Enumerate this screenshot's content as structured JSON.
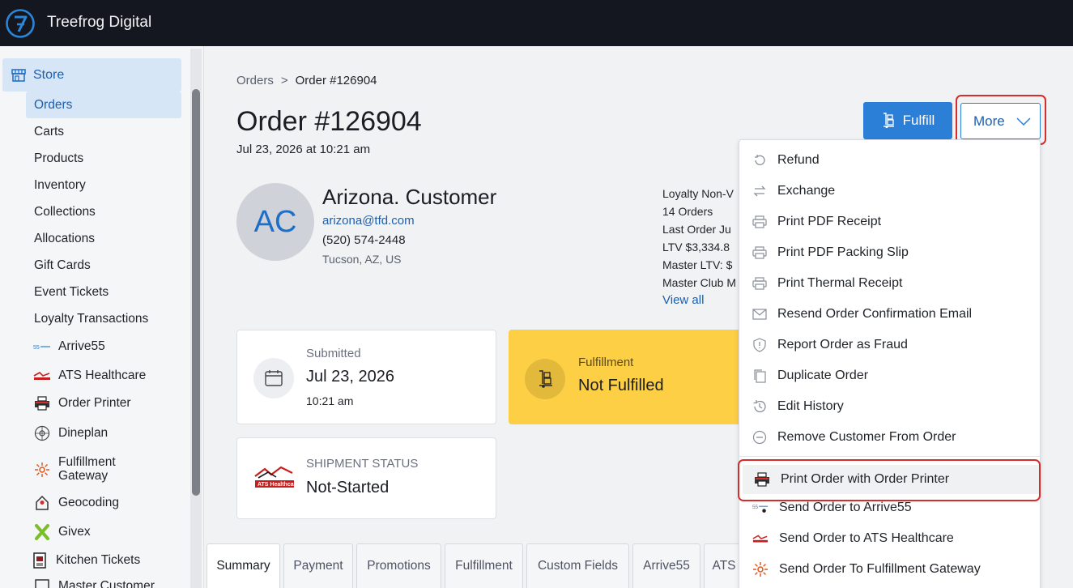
{
  "app": {
    "title": "Treefrog Digital"
  },
  "sidebar": {
    "store_label": "Store",
    "items": [
      "Orders",
      "Carts",
      "Products",
      "Inventory",
      "Collections",
      "Allocations",
      "Gift Cards",
      "Event Tickets",
      "Loyalty Transactions"
    ],
    "apps": [
      {
        "label": "Arrive55",
        "icon": "arrive55-icon"
      },
      {
        "label": "ATS Healthcare",
        "icon": "ats-healthcare-icon"
      },
      {
        "label": "Order Printer",
        "icon": "printer-icon"
      },
      {
        "label": "Dineplan",
        "icon": "dineplan-icon"
      },
      {
        "label": "Fulfillment Gateway",
        "label_line1": "Fulfillment",
        "label_line2": "Gateway",
        "icon": "fulfillment-gateway-icon"
      },
      {
        "label": "Geocoding",
        "icon": "geocoding-icon"
      },
      {
        "label": "Givex",
        "icon": "givex-icon"
      },
      {
        "label": "Kitchen Tickets",
        "icon": "kitchen-tickets-icon"
      },
      {
        "label": "Master Customer",
        "icon": "master-customer-icon"
      }
    ]
  },
  "breadcrumb": {
    "parent": "Orders",
    "separator": ">",
    "current": "Order #126904"
  },
  "order": {
    "title": "Order #126904",
    "date": "Jul 23, 2026 at 10:21 am"
  },
  "buttons": {
    "fulfill": "Fulfill",
    "more": "More"
  },
  "customer": {
    "initials": "AC",
    "name": "Arizona. Customer",
    "email": "arizona@tfd.com",
    "phone": "(520) 574-2448",
    "location": "Tucson, AZ, US"
  },
  "loyalty": {
    "line1": "Loyalty Non-V",
    "line2": "14 Orders",
    "line3": "Last Order Ju",
    "line4": "LTV  $3,334.8",
    "line5": "Master LTV: $",
    "line6": "Master Club M",
    "view_all": "View all"
  },
  "cards": {
    "submitted": {
      "label": "Submitted",
      "date": "Jul 23, 2026",
      "time": "10:21 am"
    },
    "fulfillment": {
      "label": "Fulfillment",
      "value": "Not Fulfilled",
      "color": "#fccf45"
    },
    "shipment": {
      "label": "SHIPMENT STATUS",
      "value": "Not-Started"
    }
  },
  "tabs": [
    "Summary",
    "Payment",
    "Promotions",
    "Fulfillment",
    "Custom Fields",
    "Arrive55",
    "ATS"
  ],
  "more_menu": {
    "items": [
      {
        "label": "Refund",
        "icon": "refund-icon"
      },
      {
        "label": "Exchange",
        "icon": "exchange-icon"
      },
      {
        "label": "Print PDF Receipt",
        "icon": "printer-icon"
      },
      {
        "label": "Print PDF Packing Slip",
        "icon": "printer-icon"
      },
      {
        "label": "Print Thermal Receipt",
        "icon": "printer-icon"
      },
      {
        "label": "Resend Order Confirmation Email",
        "icon": "mail-icon"
      },
      {
        "label": "Report Order as Fraud",
        "icon": "shield-icon"
      },
      {
        "label": "Duplicate Order",
        "icon": "duplicate-icon"
      },
      {
        "label": "Edit History",
        "icon": "history-icon"
      },
      {
        "label": "Remove Customer From Order",
        "icon": "remove-icon"
      }
    ],
    "app_items": [
      {
        "label": "Print Order with Order Printer",
        "icon": "order-printer-icon"
      },
      {
        "label": "Send Order to Arrive55",
        "icon": "arrive55-icon"
      },
      {
        "label": "Send Order to ATS Healthcare",
        "icon": "ats-healthcare-icon"
      },
      {
        "label": "Send Order To Fulfillment Gateway",
        "icon": "fulfillment-gateway-icon"
      }
    ]
  },
  "colors": {
    "accent": "#2b7fd6",
    "highlight": "#d62c2c",
    "topbar": "#14171f"
  }
}
